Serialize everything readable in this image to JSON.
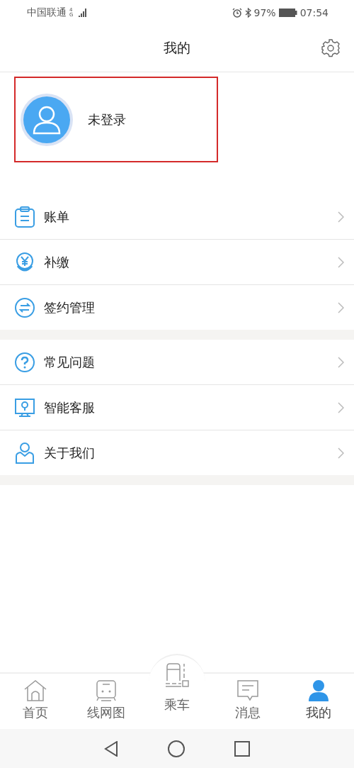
{
  "status_bar": {
    "carrier": "中国联通",
    "network": "4G",
    "battery": "97%",
    "time": "07:54"
  },
  "header": {
    "title": "我的"
  },
  "profile": {
    "name": "未登录",
    "highlighted": true
  },
  "menu_groups": [
    {
      "items": [
        {
          "kind": "clipboard",
          "label": "账单"
        },
        {
          "kind": "coin",
          "label": "补缴"
        },
        {
          "kind": "exchange",
          "label": "签约管理"
        }
      ]
    },
    {
      "items": [
        {
          "kind": "question",
          "label": "常见问题"
        },
        {
          "kind": "monitor",
          "label": "智能客服"
        },
        {
          "kind": "person",
          "label": "关于我们"
        }
      ]
    }
  ],
  "tab_bar": [
    {
      "kind": "home",
      "label": "首页",
      "selected": false
    },
    {
      "kind": "train",
      "label": "线网图",
      "selected": false
    },
    {
      "kind": "ride",
      "label": "乘车",
      "selected": false,
      "raised": true
    },
    {
      "kind": "message",
      "label": "消息",
      "selected": false
    },
    {
      "kind": "user",
      "label": "我的",
      "selected": true
    }
  ]
}
